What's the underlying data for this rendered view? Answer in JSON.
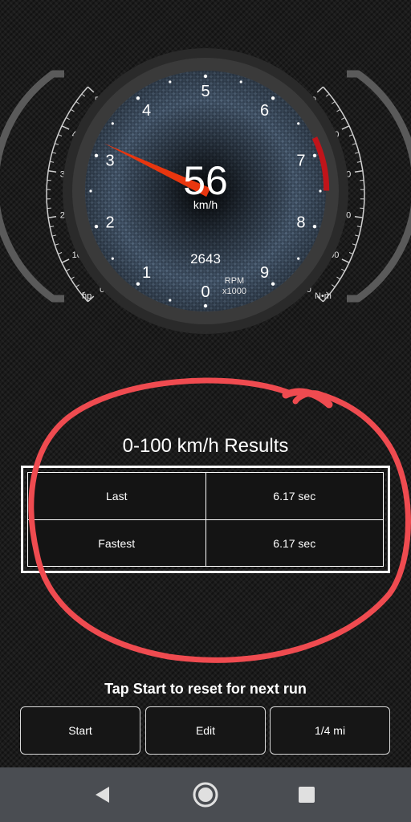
{
  "speedometer": {
    "speed": "56",
    "speed_unit": "km/h",
    "rpm": "2643",
    "rpm_unit": "RPM",
    "rpm_multiplier": "x1000",
    "rpm_labels": [
      "0",
      "1",
      "2",
      "3",
      "4",
      "5",
      "6",
      "7",
      "8",
      "9"
    ],
    "needle_rpm": 3.2
  },
  "power_gauge": {
    "labels": [
      "500",
      "400",
      "300",
      "200",
      "100",
      "0"
    ],
    "unit": "hp"
  },
  "torque_gauge": {
    "labels": [
      "500",
      "400",
      "300",
      "200",
      "100",
      "0"
    ],
    "unit": "N•m"
  },
  "results": {
    "title": "0-100 km/h Results",
    "rows": [
      {
        "label": "Last",
        "value": "6.17 sec"
      },
      {
        "label": "Fastest",
        "value": "6.17 sec"
      }
    ]
  },
  "hint": "Tap Start to reset for next run",
  "buttons": {
    "start": "Start",
    "edit": "Edit",
    "distance": "1/4 mi"
  },
  "colors": {
    "needle": "#e8360f",
    "redline": "#c0141a",
    "annotation": "#ef4b50",
    "navbar": "#4a4d52"
  }
}
